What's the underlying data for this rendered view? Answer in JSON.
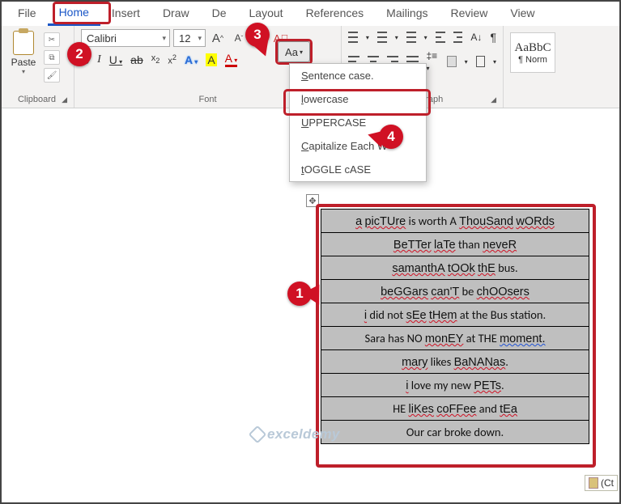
{
  "tabs": {
    "file": "File",
    "home": "Home",
    "insert": "Insert",
    "draw": "Draw",
    "design": "De",
    "layout": "Layout",
    "references": "References",
    "mailings": "Mailings",
    "review": "Review",
    "view": "View"
  },
  "clipboard": {
    "paste": "Paste",
    "group": "Clipboard"
  },
  "font": {
    "name": "Calibri",
    "size": "12",
    "grow": "A",
    "shrink": "A",
    "case": "Aa",
    "clear": "A",
    "group": "Font"
  },
  "paragraph": {
    "group": "Paragraph"
  },
  "styles": {
    "s1_prev": "AaBbC",
    "s1_name": "¶ Norm"
  },
  "case_menu": {
    "sentence": "Sentence case.",
    "lower": "lowercase",
    "upper": "UPPERCASE",
    "capword": "Capitalize Each W",
    "toggle": "tOGGLE cASE"
  },
  "badges": {
    "b1": "1",
    "b2": "2",
    "b3": "3",
    "b4": "4"
  },
  "table": {
    "rows": [
      "a picTUre is worth A ThouSand wORds",
      "BeTTer laTe than neveR",
      "samanthA tOOk thE bus.",
      "beGGars can'T be chOOsers",
      "i did not sEe tHem at the Bus station.",
      "Sara has NO monEY at THE moment.",
      "mary likes BaNANas.",
      "i love my new PETs.",
      "HE liKes coFFee and tEa",
      "Our car broke down."
    ]
  },
  "watermark": "exceldemy",
  "ct": "(Ct"
}
